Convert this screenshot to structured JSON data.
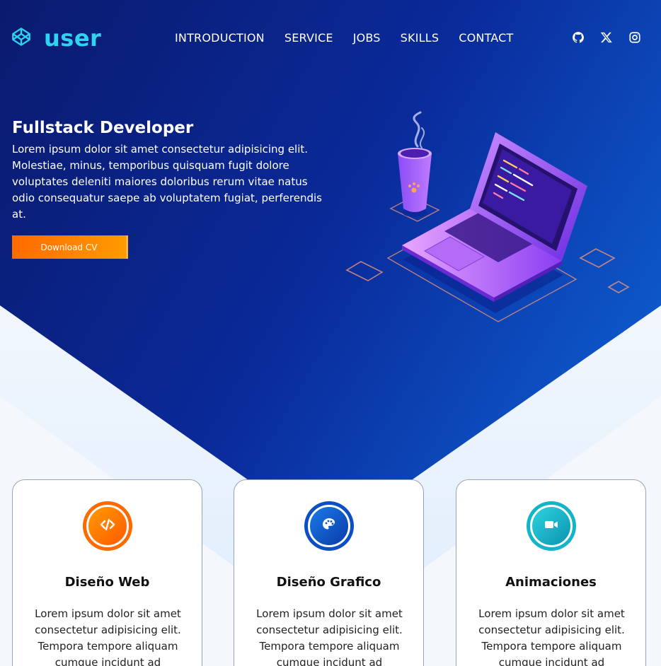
{
  "logo": {
    "text": "user"
  },
  "nav": [
    "INTRODUCTION",
    "SERVICE",
    "JOBS",
    "SKILLS",
    "CONTACT"
  ],
  "social": [
    "github-icon",
    "x-icon",
    "instagram-icon"
  ],
  "intro": {
    "title": "Fullstack Developer",
    "text": "Lorem ipsum dolor sit amet consectetur adipisicing elit. Molestiae, minus, temporibus quisquam fugit dolore voluptates deleniti maiores doloribus rerum vitae natus odio consequatur saepe ab voluptatem fugiat, perferendis at.",
    "button": "Download CV"
  },
  "cards": [
    {
      "icon": "code-icon",
      "title": "Diseño Web",
      "text": "Lorem ipsum dolor sit amet consectetur adipisicing elit. Tempora tempore aliquam cumque incidunt ad",
      "color": "#ff6a00"
    },
    {
      "icon": "palette-icon",
      "title": "Diseño Grafico",
      "text": "Lorem ipsum dolor sit amet consectetur adipisicing elit. Tempora tempore aliquam cumque incidunt ad",
      "color": "#0a4fc4"
    },
    {
      "icon": "video-icon",
      "title": "Animaciones",
      "text": "Lorem ipsum dolor sit amet consectetur adipisicing elit. Tempora tempore aliquam cumque incidunt ad",
      "color": "#12b5c8"
    }
  ],
  "colors": {
    "accent_cyan": "#2fd3f0",
    "button_orange": "#ff7a00",
    "hero_dark": "#0a1a6e",
    "hero_light": "#0a86ea"
  }
}
